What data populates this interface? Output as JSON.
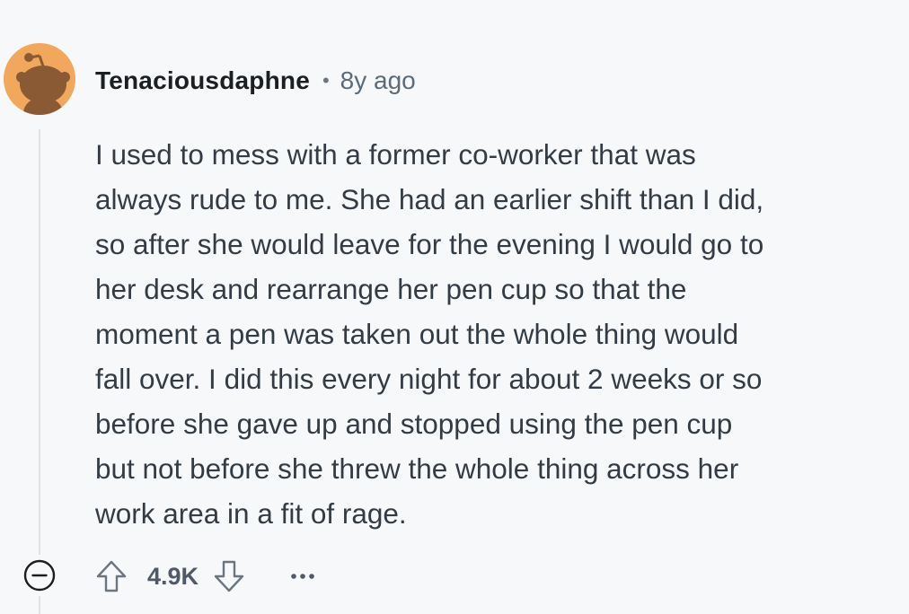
{
  "comment": {
    "username": "Tenaciousdaphne",
    "separator": "•",
    "timestamp": "8y ago",
    "body": "I used to mess with a former co-worker that was\nalways rude to me. She had an earlier shift than I did,\nso after she would leave for the evening I would go to\nher desk and rearrange her pen cup so that the\nmoment a pen was taken out the whole thing would\nfall over. I did this every night for about 2 weeks or so\nbefore she gave up and stopped using the pen cup\nbut not before she threw the whole thing across her\nwork area in a fit of rage.",
    "score": "4.9K"
  },
  "icons": {
    "avatar": "snoo-avatar",
    "collapse": "collapse-minus-icon",
    "upvote": "upvote-arrow-icon",
    "downvote": "downvote-arrow-icon",
    "more": "more-options-icon"
  },
  "colors": {
    "background": "#f7f8fa",
    "avatar_bg": "#f2a85c",
    "avatar_figure": "#8a5a34",
    "text": "#333c44",
    "muted": "#5c6b7a"
  }
}
